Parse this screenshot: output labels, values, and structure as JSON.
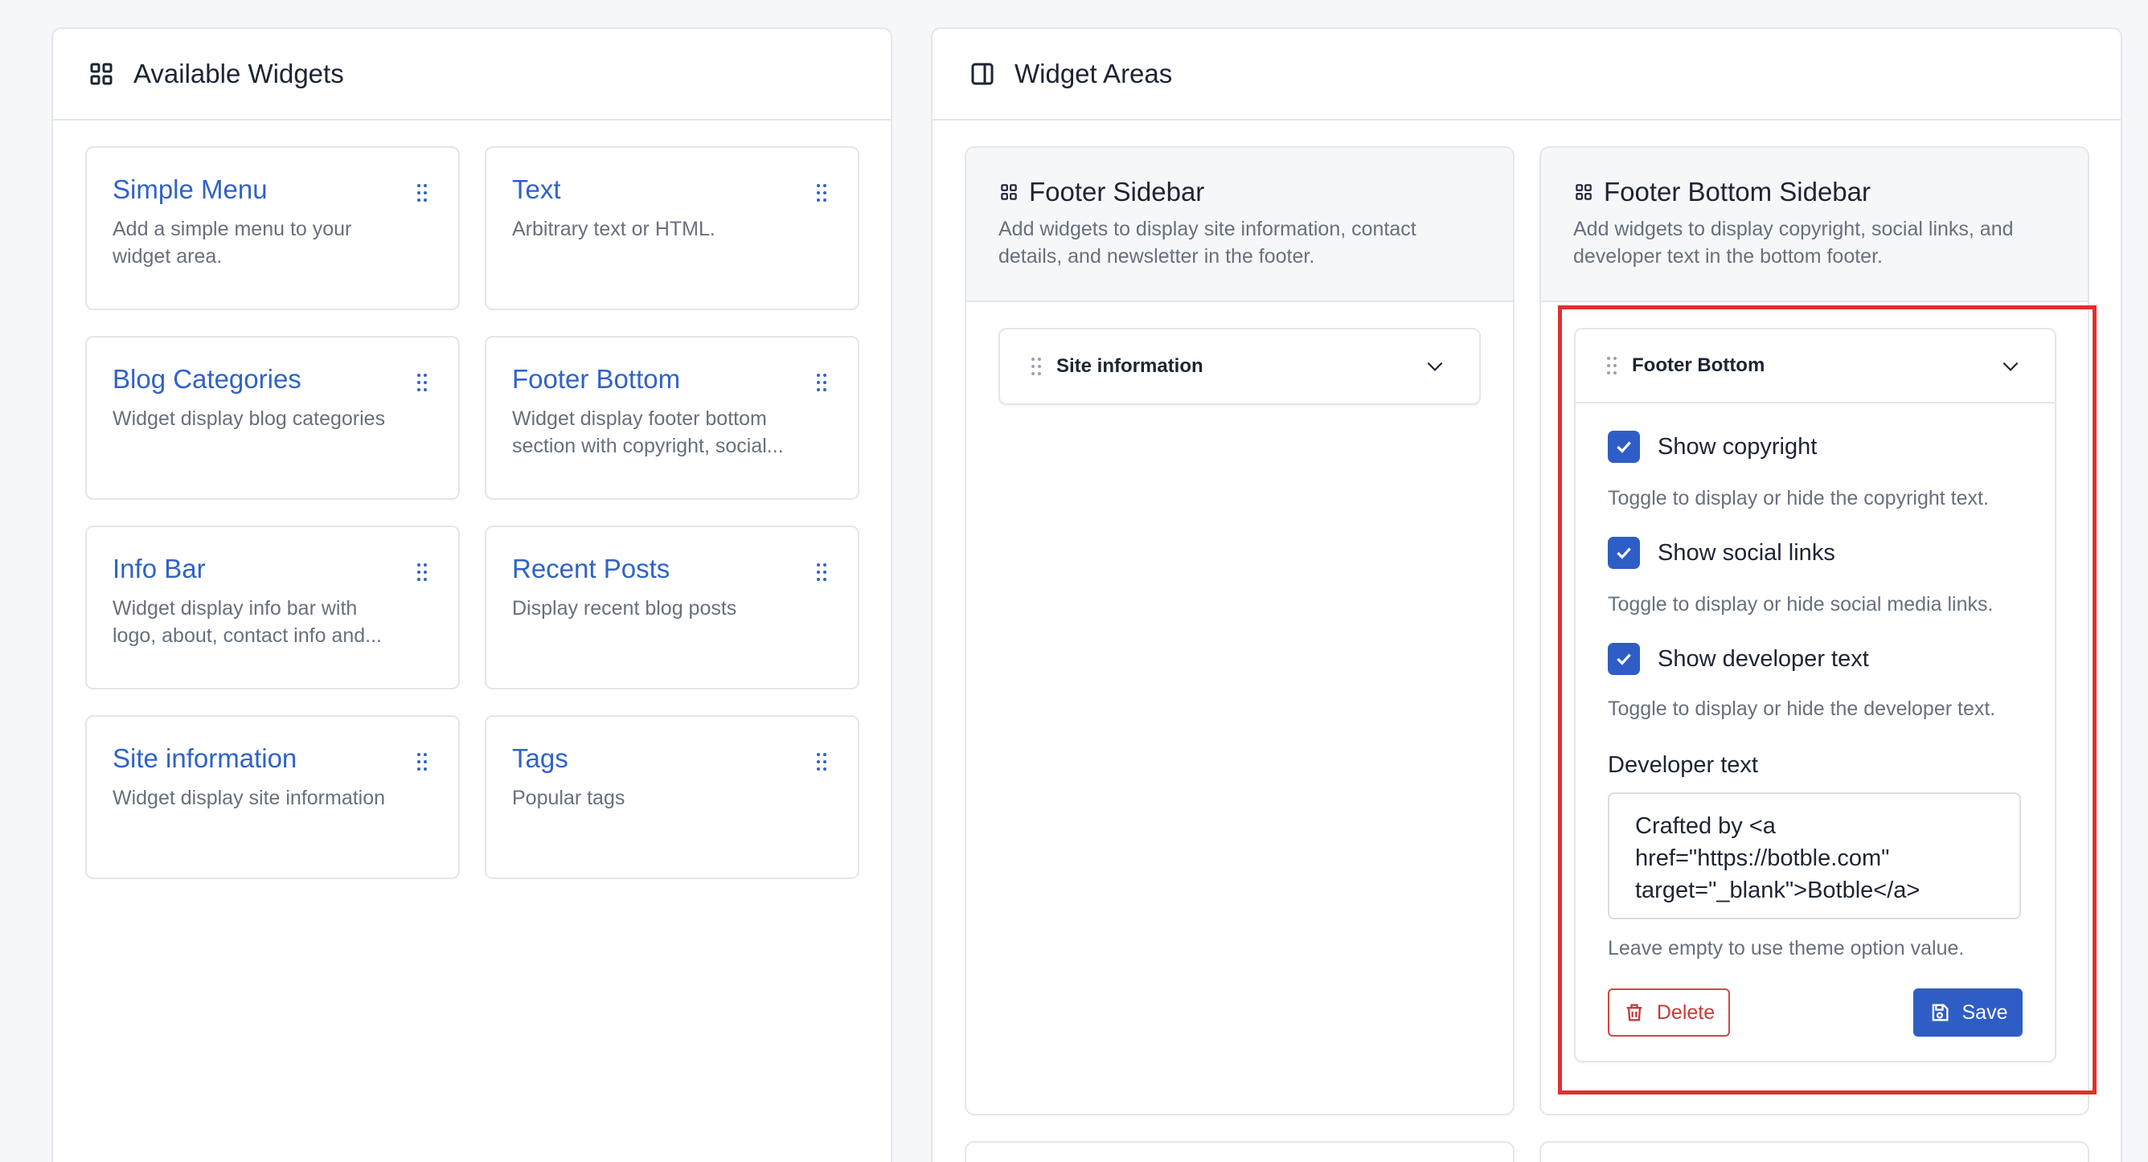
{
  "available": {
    "title": "Available Widgets",
    "widgets": [
      {
        "title": "Simple Menu",
        "desc": "Add a simple menu to your widget area."
      },
      {
        "title": "Text",
        "desc": "Arbitrary text or HTML."
      },
      {
        "title": "Blog Categories",
        "desc": "Widget display blog categories"
      },
      {
        "title": "Footer Bottom",
        "desc": "Widget display footer bottom section with copyright, social..."
      },
      {
        "title": "Info Bar",
        "desc": "Widget display info bar with logo, about, contact info and..."
      },
      {
        "title": "Recent Posts",
        "desc": "Display recent blog posts"
      },
      {
        "title": "Site information",
        "desc": "Widget display site information"
      },
      {
        "title": "Tags",
        "desc": "Popular tags"
      }
    ]
  },
  "areas": {
    "title": "Widget Areas",
    "footer_sidebar": {
      "title": "Footer Sidebar",
      "desc": "Add widgets to display site information, contact details, and newsletter in the footer.",
      "items": [
        {
          "label": "Site information"
        }
      ]
    },
    "footer_bottom_sidebar": {
      "title": "Footer Bottom Sidebar",
      "desc": "Add widgets to display copyright, social links, and developer text in the bottom footer.",
      "widget": {
        "label": "Footer Bottom",
        "show_copyright": {
          "label": "Show copyright",
          "checked": true,
          "hint": "Toggle to display or hide the copyright text."
        },
        "show_social": {
          "label": "Show social links",
          "checked": true,
          "hint": "Toggle to display or hide social media links."
        },
        "show_dev": {
          "label": "Show developer text",
          "checked": true,
          "hint": "Toggle to display or hide the developer text."
        },
        "dev_text_label": "Developer text",
        "dev_text_value": "Crafted by <a href=\"https://botble.com\" target=\"_blank\">Botble</a>",
        "dev_text_hint": "Leave empty to use theme option value.",
        "delete_label": "Delete",
        "save_label": "Save"
      }
    }
  },
  "colors": {
    "accent": "#2e5ec5",
    "link": "#2f63c7",
    "danger": "#d64545",
    "highlight": "#e1302d"
  }
}
